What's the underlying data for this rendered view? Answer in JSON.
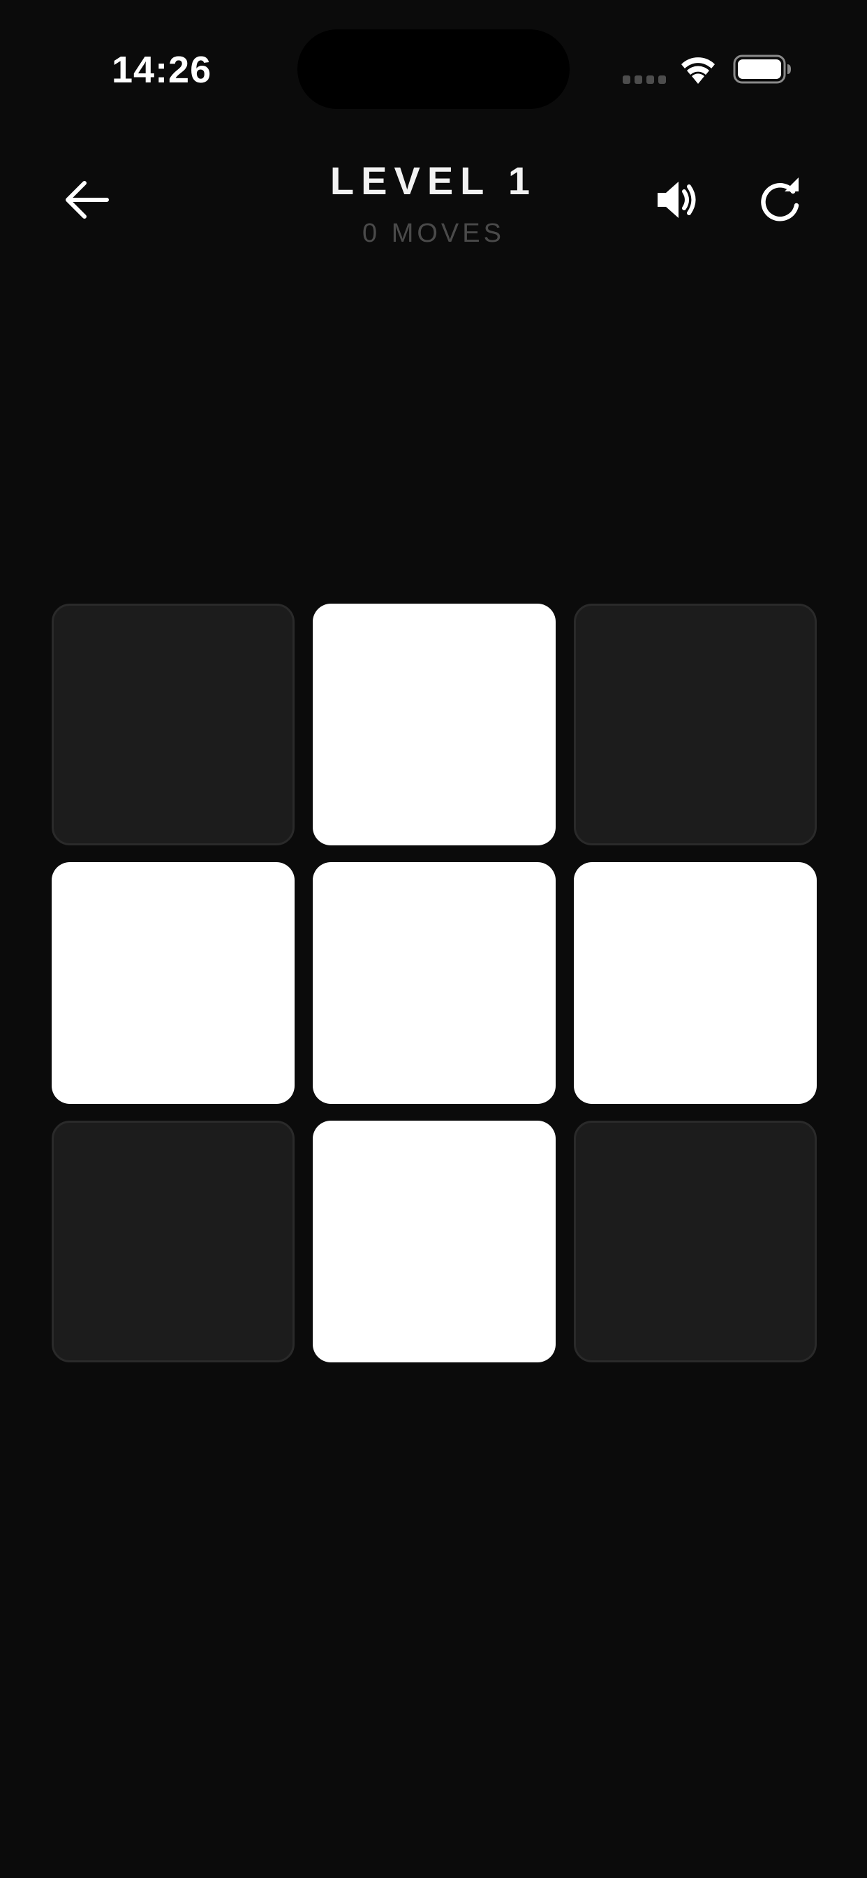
{
  "status_bar": {
    "time": "14:26"
  },
  "header": {
    "title": "LEVEL 1",
    "moves_label": "0 MOVES",
    "back_icon": "arrow-left-icon",
    "sound_icon": "speaker-icon",
    "reset_icon": "refresh-icon"
  },
  "board": {
    "rows": 3,
    "cols": 3,
    "tiles": [
      [
        "off",
        "on",
        "off"
      ],
      [
        "on",
        "on",
        "on"
      ],
      [
        "off",
        "on",
        "off"
      ]
    ]
  },
  "colors": {
    "background": "#0b0b0b",
    "tile_on": "#ffffff",
    "tile_off": "#1c1c1c",
    "moves_text": "#4a4a4a"
  }
}
